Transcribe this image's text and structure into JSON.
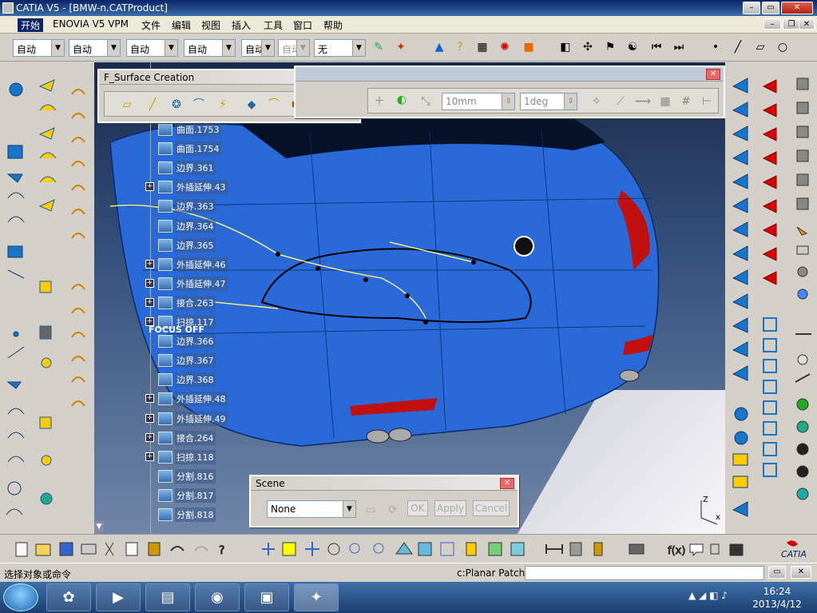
{
  "window": {
    "title": "CATIA V5 - [BMW-n.CATProduct]"
  },
  "menu": [
    "开始",
    "ENOVIA V5 VPM",
    "文件",
    "编辑",
    "视图",
    "插入",
    "工具",
    "窗口",
    "帮助"
  ],
  "toolbar_top": {
    "combos": [
      "自动",
      "自动",
      "自动",
      "自动",
      "自动",
      "自动",
      "无"
    ]
  },
  "spec_tree": {
    "nodes": [
      {
        "label": "曲面.1753",
        "expandable": false
      },
      {
        "label": "曲面.1754",
        "expandable": false
      },
      {
        "label": "边界.361",
        "expandable": false
      },
      {
        "label": "外插延伸.43",
        "expandable": true
      },
      {
        "label": "边界.363",
        "expandable": false
      },
      {
        "label": "边界.364",
        "expandable": false
      },
      {
        "label": "边界.365",
        "expandable": false
      },
      {
        "label": "外插延伸.46",
        "expandable": true
      },
      {
        "label": "外插延伸.47",
        "expandable": true
      },
      {
        "label": "接合.263",
        "expandable": true
      },
      {
        "label": "扫掠.117",
        "expandable": true
      },
      {
        "label": "边界.366",
        "expandable": false
      },
      {
        "label": "边界.367",
        "expandable": false
      },
      {
        "label": "边界.368",
        "expandable": false
      },
      {
        "label": "外插延伸.48",
        "expandable": true
      },
      {
        "label": "外插延伸.49",
        "expandable": true
      },
      {
        "label": "接合.264",
        "expandable": true
      },
      {
        "label": "扫掠.118",
        "expandable": true
      },
      {
        "label": "分割.816",
        "expandable": false
      },
      {
        "label": "分割.817",
        "expandable": false
      },
      {
        "label": "分割.818",
        "expandable": false
      }
    ],
    "focus_label": "FOCUS OFF"
  },
  "fsurface_toolbar": {
    "title": "F_Surface Creation"
  },
  "tools_toolbar": {
    "length_value": "10mm",
    "angle_value": "1deg"
  },
  "scene_dialog": {
    "title": "Scene",
    "select_value": "None",
    "ok": "OK",
    "apply": "Apply",
    "cancel": "Cancel"
  },
  "axis": {
    "z": "Z",
    "x": "x"
  },
  "status": {
    "prompt": "选择对象或命令",
    "command_label": "c:Planar Patch",
    "command_value": ""
  },
  "taskbar": {
    "time": "16:24",
    "date": "2013/4/12"
  },
  "colors": {
    "car_body": "#2a6ad8",
    "tail_light": "#c01010",
    "title_bar": "#0a246a"
  }
}
